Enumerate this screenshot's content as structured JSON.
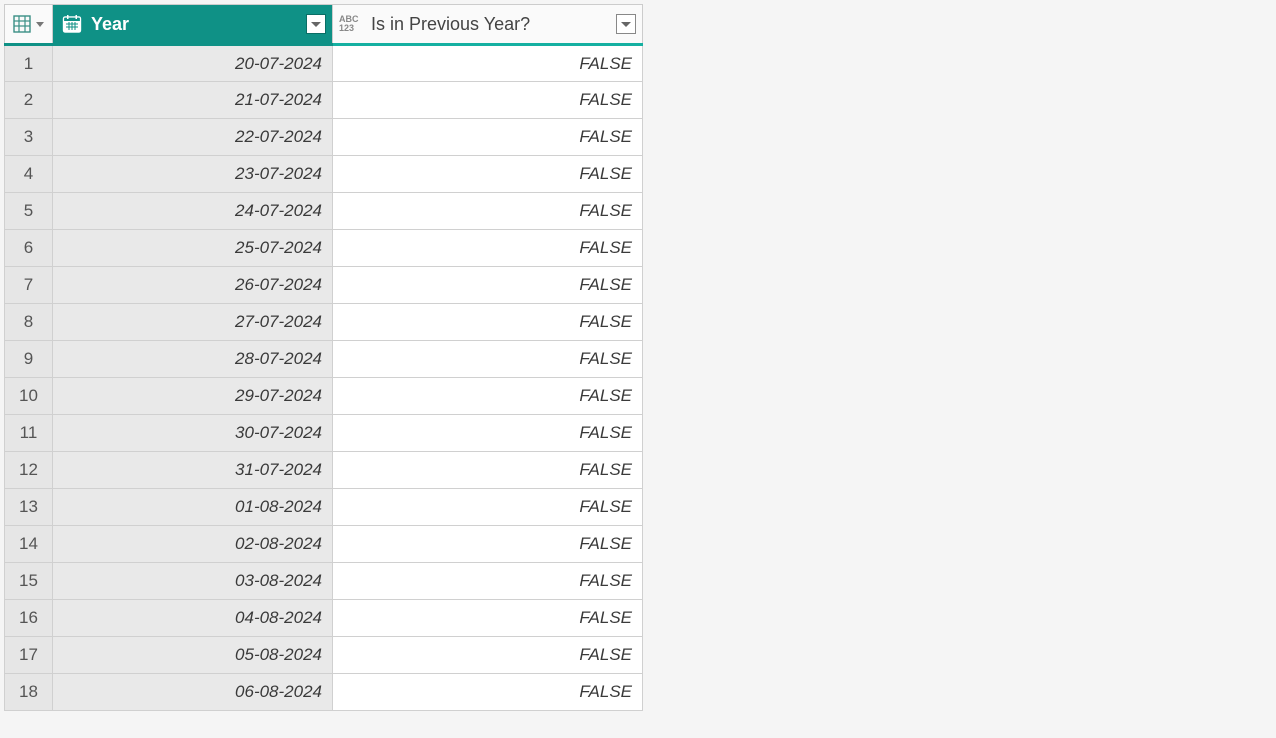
{
  "columns": {
    "year": {
      "label": "Year"
    },
    "prev": {
      "label": "Is in Previous Year?",
      "type_top": "ABC",
      "type_bottom": "123"
    }
  },
  "rows": [
    {
      "idx": "1",
      "year": "20-07-2024",
      "prev": "FALSE"
    },
    {
      "idx": "2",
      "year": "21-07-2024",
      "prev": "FALSE"
    },
    {
      "idx": "3",
      "year": "22-07-2024",
      "prev": "FALSE"
    },
    {
      "idx": "4",
      "year": "23-07-2024",
      "prev": "FALSE"
    },
    {
      "idx": "5",
      "year": "24-07-2024",
      "prev": "FALSE"
    },
    {
      "idx": "6",
      "year": "25-07-2024",
      "prev": "FALSE"
    },
    {
      "idx": "7",
      "year": "26-07-2024",
      "prev": "FALSE"
    },
    {
      "idx": "8",
      "year": "27-07-2024",
      "prev": "FALSE"
    },
    {
      "idx": "9",
      "year": "28-07-2024",
      "prev": "FALSE"
    },
    {
      "idx": "10",
      "year": "29-07-2024",
      "prev": "FALSE"
    },
    {
      "idx": "11",
      "year": "30-07-2024",
      "prev": "FALSE"
    },
    {
      "idx": "12",
      "year": "31-07-2024",
      "prev": "FALSE"
    },
    {
      "idx": "13",
      "year": "01-08-2024",
      "prev": "FALSE"
    },
    {
      "idx": "14",
      "year": "02-08-2024",
      "prev": "FALSE"
    },
    {
      "idx": "15",
      "year": "03-08-2024",
      "prev": "FALSE"
    },
    {
      "idx": "16",
      "year": "04-08-2024",
      "prev": "FALSE"
    },
    {
      "idx": "17",
      "year": "05-08-2024",
      "prev": "FALSE"
    },
    {
      "idx": "18",
      "year": "06-08-2024",
      "prev": "FALSE"
    }
  ]
}
